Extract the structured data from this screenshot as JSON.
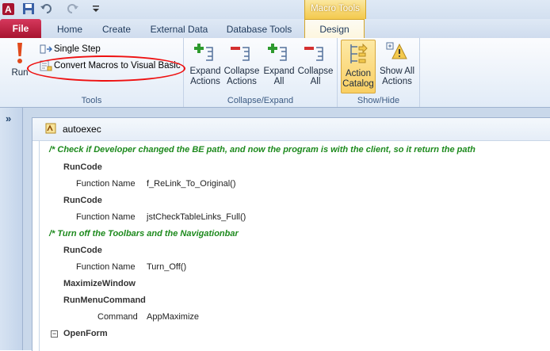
{
  "quick_access": {
    "icons": [
      "access-app-icon",
      "save-icon",
      "undo-icon",
      "redo-icon",
      "customize-icon"
    ]
  },
  "context_tab_group": "Macro Tools",
  "tabs": [
    {
      "label": "File"
    },
    {
      "label": "Home"
    },
    {
      "label": "Create"
    },
    {
      "label": "External Data"
    },
    {
      "label": "Database Tools"
    },
    {
      "label": "Design"
    }
  ],
  "ribbon": {
    "tools": {
      "label": "Tools",
      "run": "Run",
      "single_step": "Single Step",
      "convert": "Convert Macros to Visual Basic"
    },
    "collapse_expand": {
      "label": "Collapse/Expand",
      "expand_actions": [
        "Expand",
        "Actions"
      ],
      "collapse_actions": [
        "Collapse",
        "Actions"
      ],
      "expand_all": [
        "Expand",
        "All"
      ],
      "collapse_all": [
        "Collapse",
        "All"
      ]
    },
    "show_hide": {
      "label": "Show/Hide",
      "action_catalog": [
        "Action",
        "Catalog"
      ],
      "show_all_actions": [
        "Show All",
        "Actions"
      ]
    }
  },
  "nav_toggle": "»",
  "document": {
    "tab_title": "autoexec",
    "lines": {
      "c1": "/*    Check if Developer changed the BE path, and now the program is with the client, so it return the path",
      "a1": "RunCode",
      "n1": "Function Name",
      "v1": "f_ReLink_To_Original()",
      "a2": "RunCode",
      "n2": "Function Name",
      "v2": "jstCheckTableLinks_Full()",
      "c2": "/*    Turn off the Toolbars and the Navigationbar",
      "a3": "RunCode",
      "n3": "Function Name",
      "v3": "Turn_Off()",
      "a4": "MaximizeWindow",
      "a5": "RunMenuCommand",
      "n5": "Command",
      "v5": "AppMaximize",
      "a6": "OpenForm"
    }
  },
  "colors": {
    "file_tab": "#a7142f",
    "context_tab": "#f3c94d",
    "comment": "#1d8a1d",
    "annotation": "#ee1111"
  }
}
